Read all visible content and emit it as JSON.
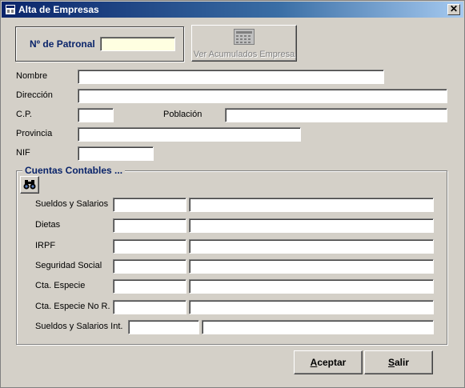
{
  "window": {
    "title": "Alta de Empresas",
    "close_glyph": "✕",
    "accent": "#0a246a"
  },
  "patronal": {
    "label": "Nº de Patronal",
    "value": ""
  },
  "acumulados_button": {
    "label": "Ver Acumulados Empresa",
    "icon": "calculator-icon"
  },
  "fields": {
    "nombre": {
      "label": "Nombre",
      "value": ""
    },
    "direccion": {
      "label": "Dirección",
      "value": ""
    },
    "cp": {
      "label": "C.P.",
      "value": ""
    },
    "poblacion": {
      "label": "Población",
      "value": ""
    },
    "provincia": {
      "label": "Provincia",
      "value": ""
    },
    "nif": {
      "label": "NIF",
      "value": ""
    }
  },
  "cuentas": {
    "title": "Cuentas Contables ...",
    "search_icon": "binoculars-icon",
    "rows": [
      {
        "label": "Sueldos y Salarios",
        "code": "",
        "desc": ""
      },
      {
        "label": "Dietas",
        "code": "",
        "desc": ""
      },
      {
        "label": "IRPF",
        "code": "",
        "desc": ""
      },
      {
        "label": "Seguridad Social",
        "code": "",
        "desc": ""
      },
      {
        "label": "Cta. Especie",
        "code": "",
        "desc": ""
      },
      {
        "label": "Cta. Especie No R.",
        "code": "",
        "desc": ""
      },
      {
        "label": "Sueldos y Salarios Int.",
        "code": "",
        "desc": ""
      }
    ]
  },
  "buttons": {
    "aceptar": {
      "label": "Aceptar",
      "hotkey_letter": "A",
      "rest": "ceptar"
    },
    "salir": {
      "label": "Salir",
      "hotkey_letter": "S",
      "rest": "alir"
    }
  }
}
